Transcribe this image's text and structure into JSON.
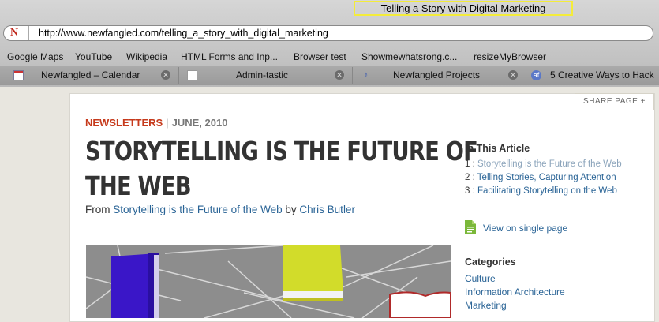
{
  "window": {
    "title": "Telling a Story with Digital Marketing"
  },
  "address": {
    "url": "http://www.newfangled.com/telling_a_story_with_digital_marketing",
    "site_icon": "N"
  },
  "bookmarks": [
    "Google Maps",
    "YouTube",
    "Wikipedia",
    "HTML Forms and Inp...",
    "Browser test",
    "Showmewhatsrong.c...",
    "resizeMyBrowser"
  ],
  "tabs": [
    {
      "label": "Newfangled – Calendar",
      "icon": "calendar-icon"
    },
    {
      "label": "Admin-tastic",
      "icon": "document-icon"
    },
    {
      "label": "Newfangled Projects",
      "icon": "project-icon"
    },
    {
      "label": "5 Creative Ways to Hack",
      "icon": "af-icon",
      "icon_text": "af"
    }
  ],
  "article": {
    "share_label": "SHARE PAGE +",
    "category": "NEWSLETTERS",
    "separator": "|",
    "date": "JUNE, 2010",
    "headline_line1": "STORYTELLING IS THE FUTURE OF",
    "headline_line2": "THE WEB",
    "byline_from": "From",
    "byline_series": "Storytelling is the Future of the Web",
    "byline_by": "by",
    "byline_author": "Chris Butler"
  },
  "sidebar": {
    "toc_heading": "In This Article",
    "toc": [
      {
        "num": "1 :",
        "label": "Storytelling is the Future of the Web"
      },
      {
        "num": "2 :",
        "label": "Telling Stories, Capturing Attention"
      },
      {
        "num": "3 :",
        "label": "Facilitating Storytelling on the Web"
      }
    ],
    "single_page": "View on single page",
    "categories_heading": "Categories",
    "categories": [
      "Culture",
      "Information Architecture",
      "Marketing"
    ]
  },
  "colors": {
    "accent": "#c63a1c",
    "link": "#2a6496",
    "highlight": "#f4ec3a"
  }
}
